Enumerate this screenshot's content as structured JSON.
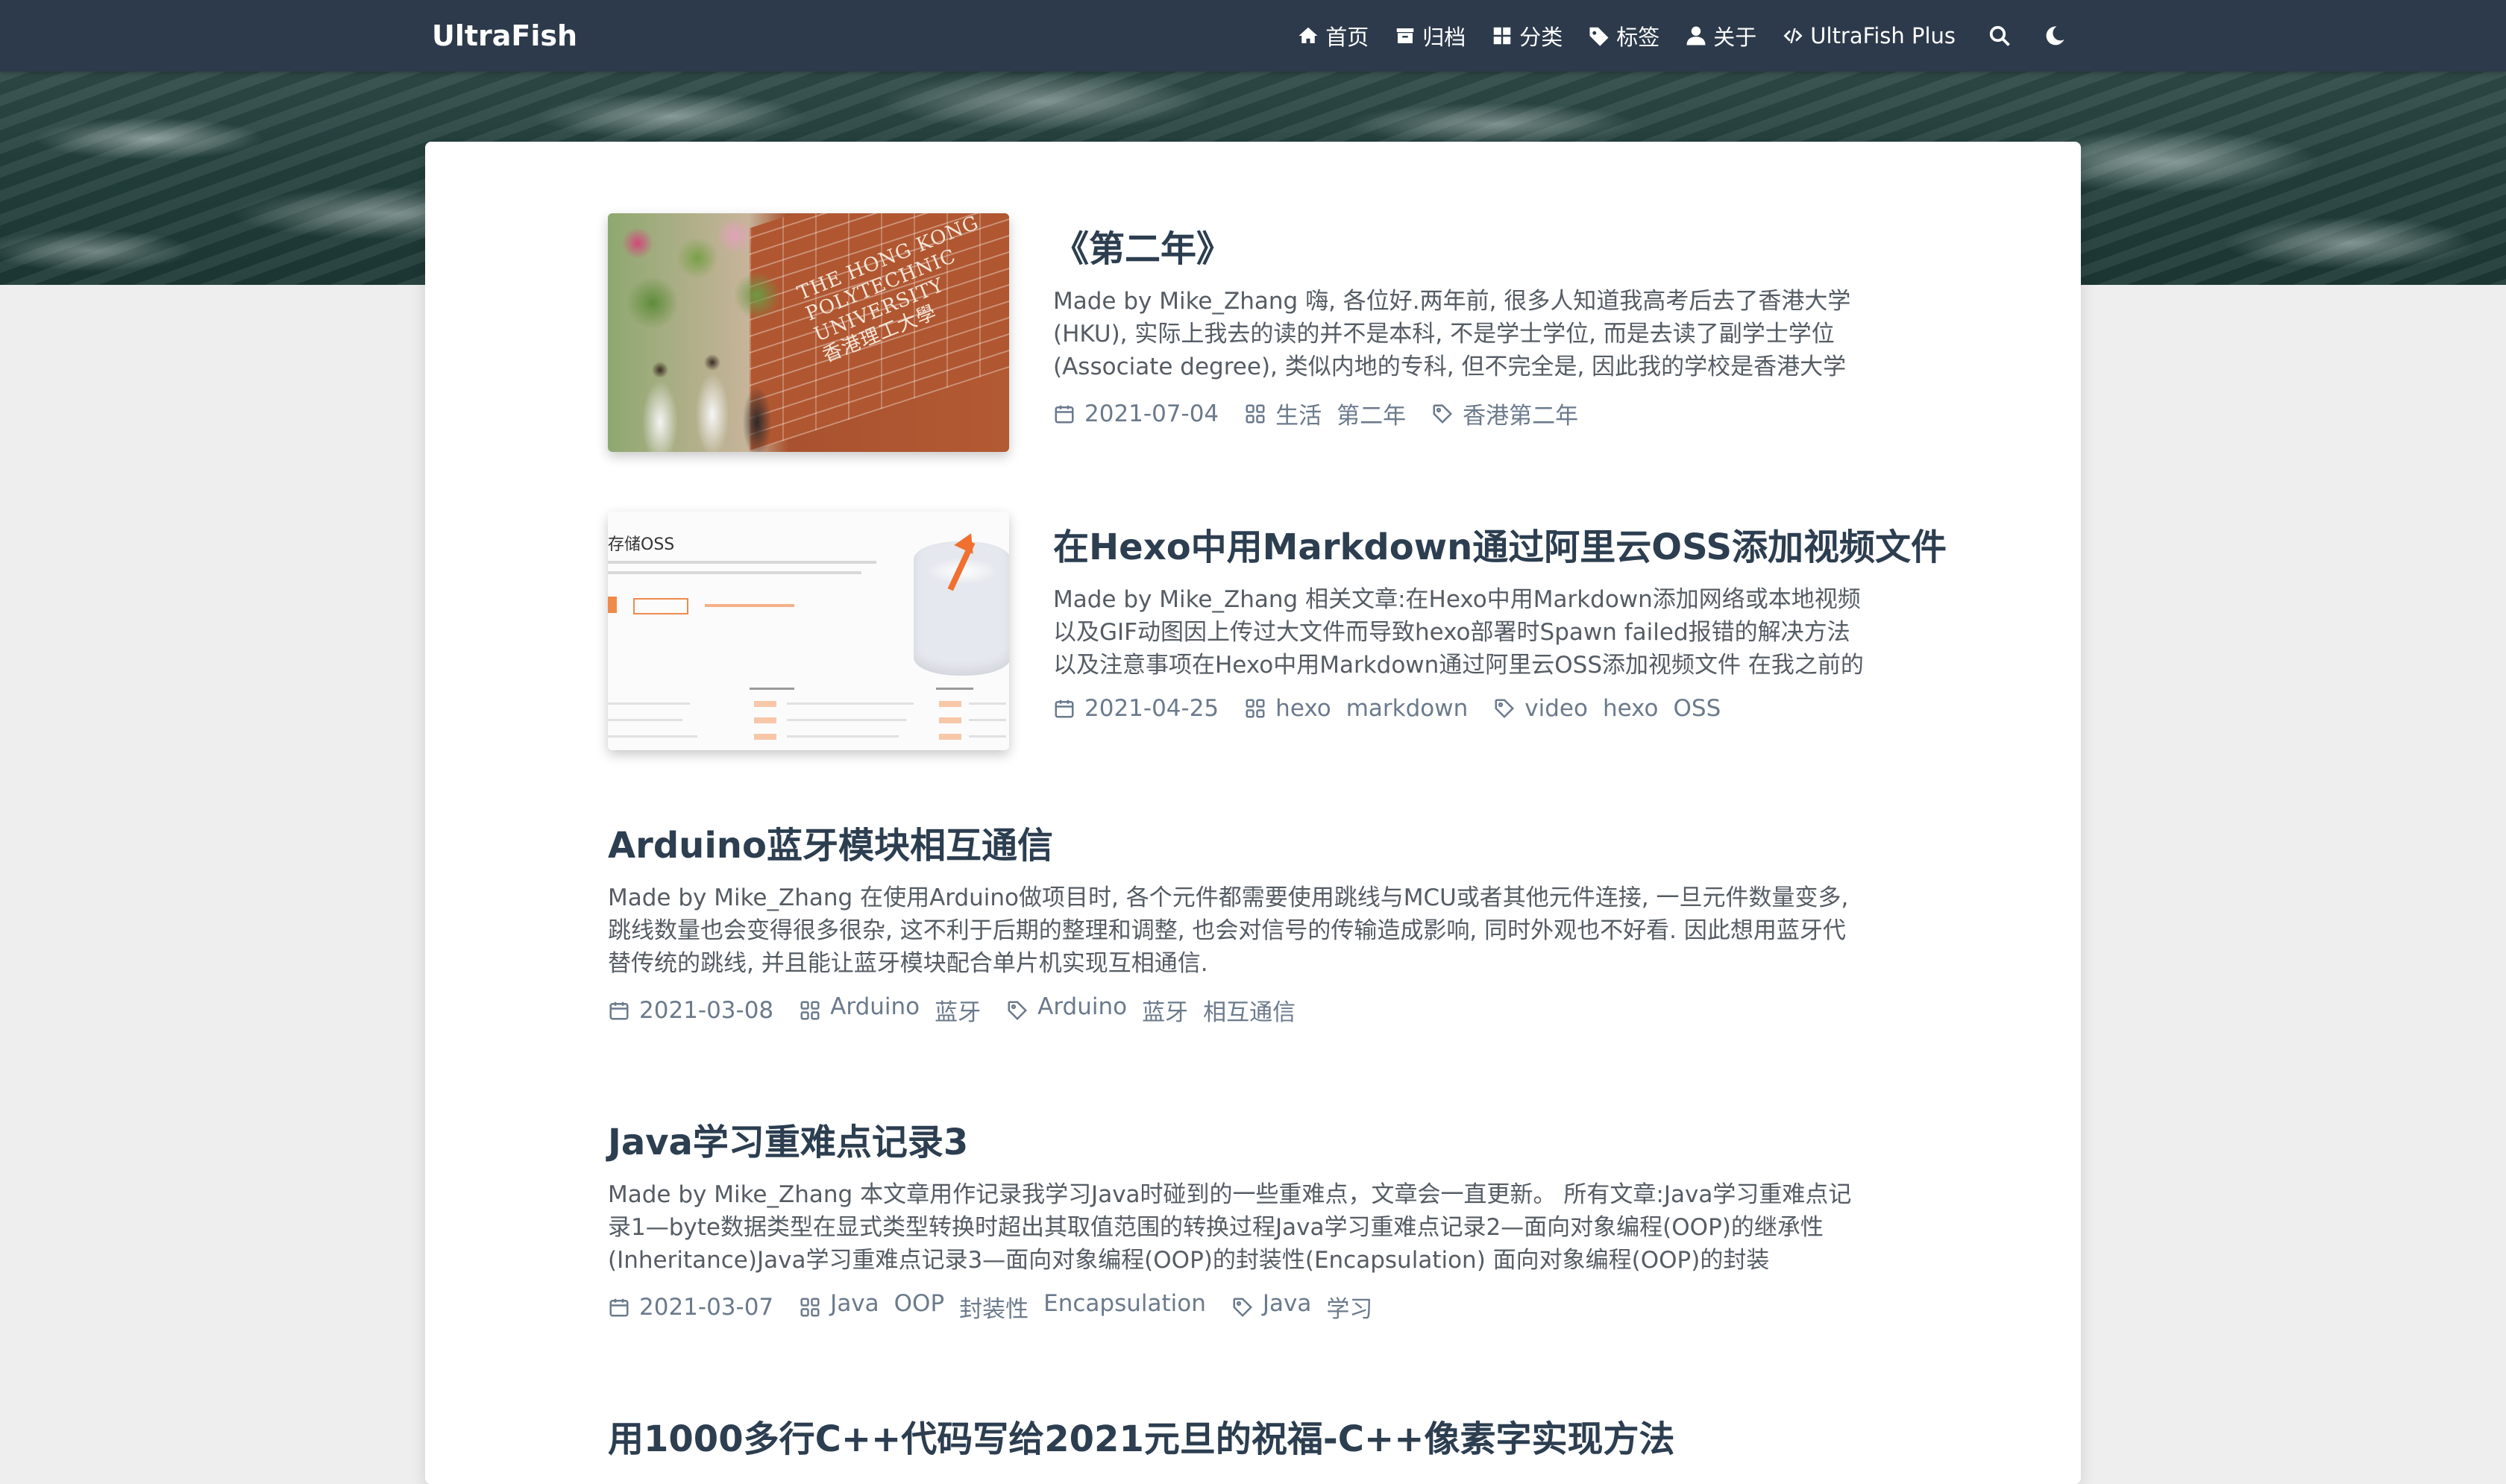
{
  "site": {
    "brand": "UltraFish",
    "nav": [
      {
        "key": "home",
        "label": "首页",
        "icon": "home-icon"
      },
      {
        "key": "archives",
        "label": "归档",
        "icon": "archive-icon"
      },
      {
        "key": "categories",
        "label": "分类",
        "icon": "category-icon"
      },
      {
        "key": "tags",
        "label": "标签",
        "icon": "tag-icon"
      },
      {
        "key": "about",
        "label": "关于",
        "icon": "user-icon"
      },
      {
        "key": "plus",
        "label": "UltraFish Plus",
        "icon": "code-icon"
      }
    ],
    "search_icon": "search-icon",
    "theme_icon": "moon-icon"
  },
  "posts": [
    {
      "title": "《第二年》",
      "excerpt": "Made by Mike_Zhang 嗨, 各位好.两年前, 很多人知道我高考后去了香港大学(HKU), 实际上我去的读的并不是本科, 不是学士学位, 而是去读了副学士学位(Associate degree), 类似内地的专科, 但不完全是, 因此我的学校是香港大学的",
      "date": "2021-07-04",
      "categories": [
        "生活",
        "第二年"
      ],
      "tags": [
        "香港第二年"
      ],
      "thumb_text": [
        "THE HONG KONG",
        "POLYTECHNIC UNIVERSITY",
        "香港理工大學"
      ]
    },
    {
      "title": "在Hexo中用Markdown通过阿里云OSS添加视频文件",
      "excerpt": "Made by Mike_Zhang 相关文章:在Hexo中用Markdown添加网络或本地视频以及GIF动图因上传过大文件而导致hexo部署时Spawn failed报错的解决方法以及注意事项在Hexo中用Markdown通过阿里云OSS添加视频文件 在我之前的文章",
      "date": "2021-04-25",
      "categories": [
        "hexo",
        "markdown"
      ],
      "tags": [
        "video",
        "hexo",
        "OSS"
      ],
      "thumb_text": [
        "存储OSS"
      ]
    },
    {
      "title": "Arduino蓝牙模块相互通信",
      "excerpt": "Made by Mike_Zhang 在使用Arduino做项目时, 各个元件都需要使用跳线与MCU或者其他元件连接, 一旦元件数量变多, 跳线数量也会变得很多很杂, 这不利于后期的整理和调整, 也会对信号的传输造成影响, 同时外观也不好看. 因此想用蓝牙代替传统的跳线, 并且能让蓝牙模块配合单片机实现互相通信.",
      "date": "2021-03-08",
      "categories": [
        "Arduino",
        "蓝牙"
      ],
      "tags": [
        "Arduino",
        "蓝牙",
        "相互通信"
      ]
    },
    {
      "title": "Java学习重难点记录3",
      "excerpt": "Made by Mike_Zhang 本文章用作记录我学习Java时碰到的一些重难点，文章会一直更新。 所有文章:Java学习重难点记录1—byte数据类型在显式类型转换时超出其取值范围的转换过程Java学习重难点记录2—面向对象编程(OOP)的继承性(Inheritance)Java学习重难点记录3—面向对象编程(OOP)的封装性(Encapsulation) 面向对象编程(OOP)的封装",
      "date": "2021-03-07",
      "categories": [
        "Java",
        "OOP",
        "封装性",
        "Encapsulation"
      ],
      "tags": [
        "Java",
        "学习"
      ]
    },
    {
      "title": "用1000多行C++代码写给2021元旦的祝福-C++像素字实现方法"
    }
  ],
  "colors": {
    "navbar": "#2d3a4b",
    "title": "#2c3e50",
    "meta": "#6b7a8c",
    "body_bg": "#eeeeee"
  }
}
